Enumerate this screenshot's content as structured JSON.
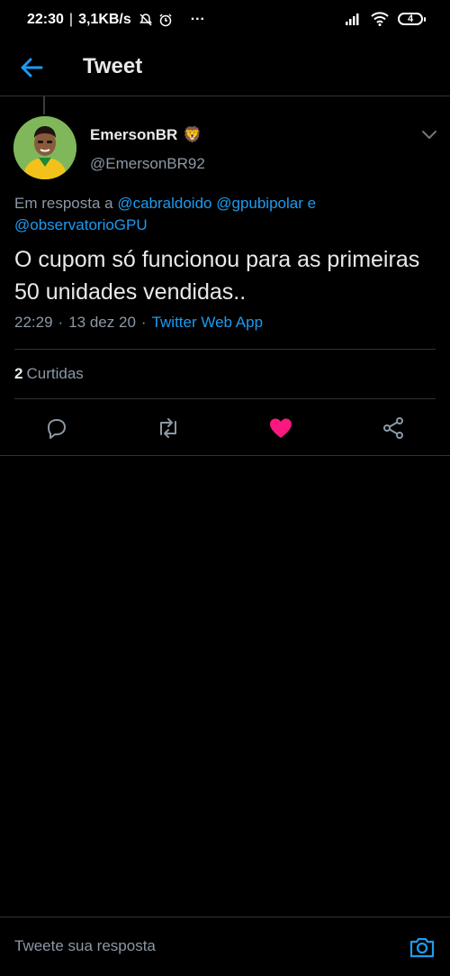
{
  "status_bar": {
    "time": "22:30",
    "speed": "3,1KB/s",
    "more": "···",
    "battery": "4"
  },
  "app_bar": {
    "title": "Tweet"
  },
  "tweet": {
    "display_name": "EmersonBR",
    "name_emoji": "🦁",
    "handle": "@EmersonBR92",
    "reply_prefix": "Em resposta a",
    "mentions": [
      "@cabraldoido",
      "@gpubipolar",
      "@observatorioGPU"
    ],
    "mention_joiner": "e",
    "text": "O cupom só funcionou para as primeiras 50 unidades vendidas..",
    "time": "22:29",
    "date": "13 dez 20",
    "source": "Twitter Web App",
    "separator": "·",
    "likes_count": "2",
    "likes_label": "Curtidas"
  },
  "composer": {
    "placeholder": "Tweete sua resposta"
  },
  "colors": {
    "accent": "#1d9bf0",
    "like": "#f91880",
    "background": "#000000"
  }
}
